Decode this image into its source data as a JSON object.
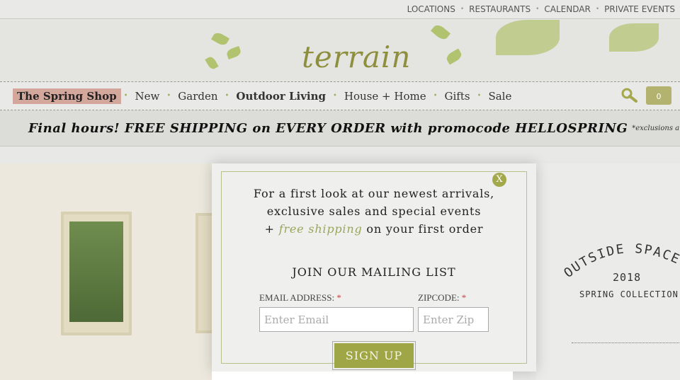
{
  "top_links": [
    "LOCATIONS",
    "RESTAURANTS",
    "CALENDAR",
    "PRIVATE EVENTS"
  ],
  "logo": "terrain",
  "nav": [
    {
      "label": "The Spring Shop"
    },
    {
      "label": "New"
    },
    {
      "label": "Garden"
    },
    {
      "label": "Outdoor Living"
    },
    {
      "label": "House + Home"
    },
    {
      "label": "Gifts"
    },
    {
      "label": "Sale"
    }
  ],
  "cart_count": "0",
  "promo": {
    "main": "Final hours! FREE SHIPPING on EVERY ORDER with promocode HELLOSPRING",
    "note": "*exclusions a"
  },
  "hero_right": {
    "arc": "OUTSIDE SPACE",
    "year": "2018",
    "collection": "SPRING COLLECTION"
  },
  "modal": {
    "close": "X",
    "line1": "For a first look at our newest arrivals, exclusive sales and special events",
    "plus": "+",
    "free": "free shipping",
    "line2": "on your first order",
    "heading": "JOIN OUR MAILING LIST",
    "email_label": "EMAIL ADDRESS:",
    "zip_label": "ZIPCODE:",
    "required": "*",
    "email_placeholder": "Enter Email",
    "zip_placeholder": "Enter Zip",
    "submit": "SIGN UP"
  }
}
